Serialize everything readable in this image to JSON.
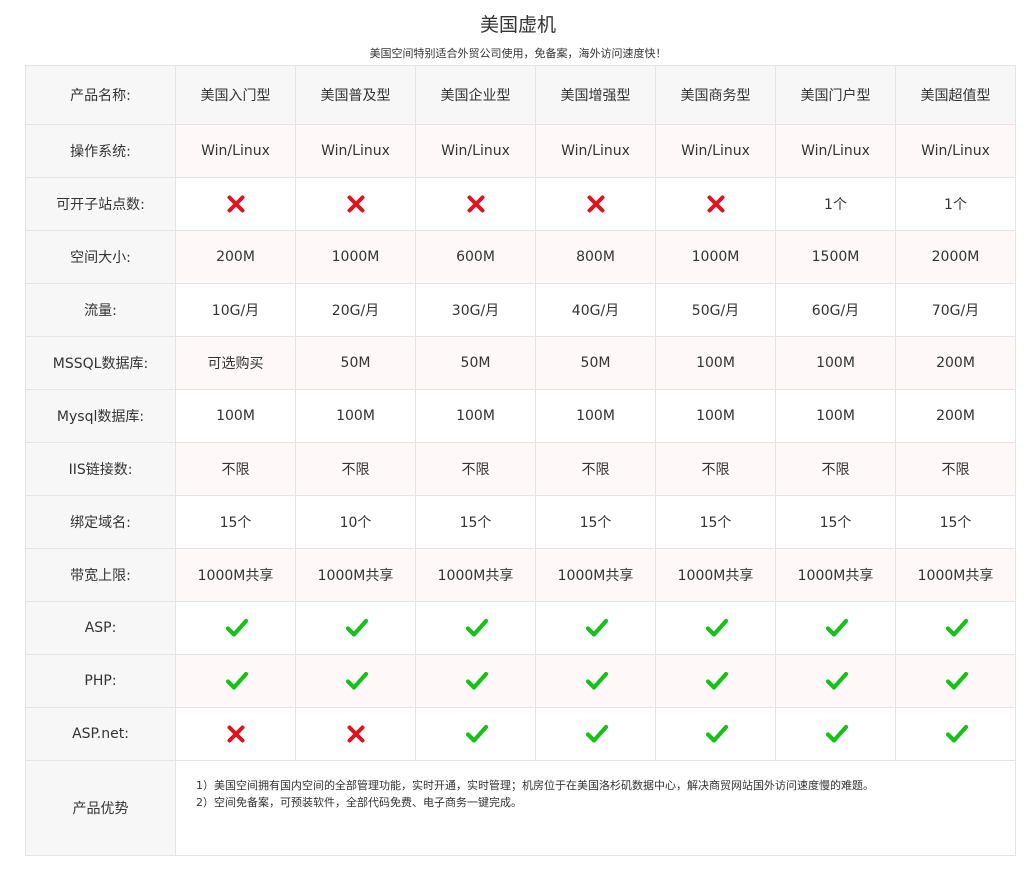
{
  "page": {
    "title": "美国虚机",
    "subtitle": "美国空间特别适合外贸公司使用，免备案，海外访问速度快！"
  },
  "table": {
    "corner_label": "产品名称:",
    "products": [
      "美国入门型",
      "美国普及型",
      "美国企业型",
      "美国增强型",
      "美国商务型",
      "美国门户型",
      "美国超值型"
    ],
    "rows": [
      {
        "label": "操作系统:",
        "values": [
          "Win/Linux",
          "Win/Linux",
          "Win/Linux",
          "Win/Linux",
          "Win/Linux",
          "Win/Linux",
          "Win/Linux"
        ]
      },
      {
        "label": "可开子站点数:",
        "values": [
          "cross-icon",
          "cross-icon",
          "cross-icon",
          "cross-icon",
          "cross-icon",
          "1个",
          "1个"
        ]
      },
      {
        "label": "空间大小:",
        "values": [
          "200M",
          "1000M",
          "600M",
          "800M",
          "1000M",
          "1500M",
          "2000M"
        ]
      },
      {
        "label": "流量:",
        "values": [
          "10G/月",
          "20G/月",
          "30G/月",
          "40G/月",
          "50G/月",
          "60G/月",
          "70G/月"
        ]
      },
      {
        "label": "MSSQL数据库:",
        "values": [
          "可选购买",
          "50M",
          "50M",
          "50M",
          "100M",
          "100M",
          "200M"
        ]
      },
      {
        "label": "Mysql数据库:",
        "values": [
          "100M",
          "100M",
          "100M",
          "100M",
          "100M",
          "100M",
          "200M"
        ]
      },
      {
        "label": "IIS链接数:",
        "values": [
          "不限",
          "不限",
          "不限",
          "不限",
          "不限",
          "不限",
          "不限"
        ]
      },
      {
        "label": "绑定域名:",
        "values": [
          "15个",
          "10个",
          "15个",
          "15个",
          "15个",
          "15个",
          "15个"
        ]
      },
      {
        "label": "带宽上限:",
        "values": [
          "1000M共享",
          "1000M共享",
          "1000M共享",
          "1000M共享",
          "1000M共享",
          "1000M共享",
          "1000M共享"
        ]
      },
      {
        "label": "ASP:",
        "values": [
          "check-icon",
          "check-icon",
          "check-icon",
          "check-icon",
          "check-icon",
          "check-icon",
          "check-icon"
        ]
      },
      {
        "label": "PHP:",
        "values": [
          "check-icon",
          "check-icon",
          "check-icon",
          "check-icon",
          "check-icon",
          "check-icon",
          "check-icon"
        ]
      },
      {
        "label": "ASP.net:",
        "values": [
          "cross-icon",
          "cross-icon",
          "check-icon",
          "check-icon",
          "check-icon",
          "check-icon",
          "check-icon"
        ]
      }
    ],
    "advantages": {
      "label": "产品优势",
      "lines": [
        "1）美国空间拥有国内空间的全部管理功能，实时开通，实时管理；机房位于在美国洛杉矶数据中心，解决商贸网站国外访问速度慢的难题。",
        "2）空间免备案，可预装软件，全部代码免费、电子商务一键完成。"
      ]
    }
  },
  "colors": {
    "cross": "#e0141e",
    "check": "#16c21a",
    "label_bg": "#f7f7f7",
    "alt_row_bg": "#fef8f8",
    "border": "#e4e4e4"
  }
}
